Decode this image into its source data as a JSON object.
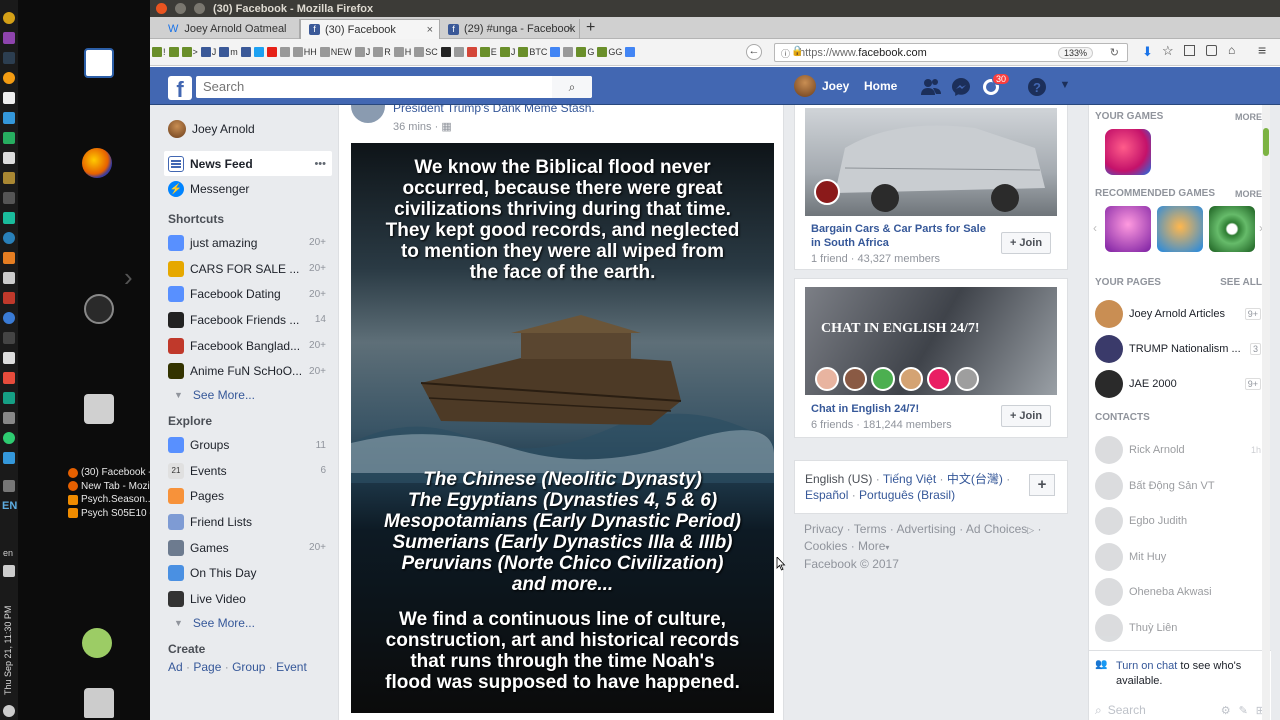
{
  "desktop": {
    "clock": "Thu Sep 21, 11:30 PM",
    "lang": "EN",
    "lang_small": "en",
    "tasks": [
      {
        "label": "(30) Facebook -...",
        "color": "#e66000"
      },
      {
        "label": "New Tab - Mozi...",
        "color": "#e66000"
      },
      {
        "label": "Psych.Season....",
        "color": "#f08c00"
      },
      {
        "label": "Psych S05E10 -...",
        "color": "#f08c00"
      }
    ]
  },
  "firefox": {
    "window_title": "(30) Facebook - Mozilla Firefox",
    "tabs": [
      {
        "label": "Joey Arnold Oatmeal"
      },
      {
        "label": "(30) Facebook"
      },
      {
        "label": "(29) #unga - Facebook"
      }
    ],
    "new_tab": "+",
    "bookmarks": [
      "!",
      ">",
      "J",
      "m",
      "HH",
      "NEW",
      "J",
      "R",
      "H",
      "SC",
      "E",
      "J",
      "BTC",
      "G",
      "G",
      "GG"
    ],
    "url_prefix": "https://www.",
    "url_domain": "facebook.com",
    "zoom": "133%"
  },
  "fb": {
    "logo": "f",
    "search_placeholder": "Search",
    "profile_name": "Joey",
    "home": "Home",
    "notif_count": "30",
    "left": {
      "user": "Joey Arnold",
      "news_feed": "News Feed",
      "news_feed_more": "•••",
      "messenger": "Messenger",
      "shortcuts_title": "Shortcuts",
      "shortcuts": [
        {
          "label": "just amazing",
          "count": "20+",
          "color": "#5890ff"
        },
        {
          "label": "CARS FOR SALE ...",
          "count": "20+",
          "color": "#e6a800"
        },
        {
          "label": "Facebook Dating",
          "count": "20+",
          "color": "#5890ff"
        },
        {
          "label": "Facebook Friends ...",
          "count": "14",
          "color": "#222222"
        },
        {
          "label": "Facebook Banglad...",
          "count": "20+",
          "color": "#c0392b"
        },
        {
          "label": "Anime FuN ScHoO...",
          "count": "20+",
          "color": "#333300"
        }
      ],
      "see_more": "See More...",
      "explore_title": "Explore",
      "explore": [
        {
          "label": "Groups",
          "count": "11",
          "color": "#5890ff"
        },
        {
          "label": "Events",
          "count": "6",
          "color": "#e0e0e0",
          "glyph": "21"
        },
        {
          "label": "Pages",
          "count": "",
          "color": "#f7923a"
        },
        {
          "label": "Friend Lists",
          "count": "",
          "color": "#7e9bd4"
        },
        {
          "label": "Games",
          "count": "20+",
          "color": "#6d7b8f"
        },
        {
          "label": "On This Day",
          "count": "",
          "color": "#4a90e2"
        },
        {
          "label": "Live Video",
          "count": "",
          "color": "#333333"
        }
      ],
      "see_more2": "See More...",
      "create_title": "Create",
      "create_links": [
        "Ad",
        "Page",
        "Group",
        "Event"
      ]
    },
    "post": {
      "page_name": "President Trump's Dank Meme Stash.",
      "time": "36 mins",
      "text_top": [
        "We know the Biblical flood never",
        "occurred, because there were great",
        "civilizations thriving during that time.",
        "They kept good records, and neglected",
        "to mention they were all wiped from",
        "the face of the earth."
      ],
      "text_mid": [
        "The Chinese (Neolitic Dynasty)",
        "The Egyptians (Dynasties 4, 5 & 6)",
        "Mesopotamians (Early Dynastic Period)",
        "Sumerians (Early Dynastics IIIa & IIIb)",
        "Peruvians (Norte Chico Civilization)",
        "and more..."
      ],
      "text_bot": [
        "We find a continuous line of culture,",
        "construction, art and historical records",
        "that runs through the time Noah's",
        "flood was supposed to have happened."
      ]
    },
    "groups": [
      {
        "name": "Bargain Cars & Car Parts for Sale in South Africa",
        "meta": "1 friend · 43,327 members",
        "join": "Join"
      },
      {
        "name": "Chat in English 24/7!",
        "meta": "6 friends · 181,244 members",
        "join": "Join",
        "banner": "CHAT IN ENGLISH 24/7!"
      }
    ],
    "languages": [
      "English (US)",
      "Tiếng Việt",
      "中文(台灣)",
      "Español",
      "Português (Brasil)"
    ],
    "footer_links": [
      "Privacy",
      "Terms",
      "Advertising",
      "Ad Choices",
      "Cookies",
      "More"
    ],
    "copyright": "Facebook © 2017",
    "sidebar": {
      "your_games": "YOUR GAMES",
      "more": "MORE",
      "recommended_games": "RECOMMENDED GAMES",
      "your_pages": "YOUR PAGES",
      "see_all": "SEE ALL",
      "pages": [
        {
          "name": "Joey Arnold Articles",
          "count": "9+"
        },
        {
          "name": "TRUMP Nationalism ...",
          "count": "3"
        },
        {
          "name": "JAE 2000",
          "count": "9+"
        }
      ],
      "contacts_title": "CONTACTS",
      "contacts": [
        {
          "name": "Rick Arnold",
          "status": "1h"
        },
        {
          "name": "Bất Động Sản VT",
          "status": ""
        },
        {
          "name": "Egbo Judith",
          "status": ""
        },
        {
          "name": "Mit Huy",
          "status": ""
        },
        {
          "name": "Oheneba Akwasi",
          "status": ""
        },
        {
          "name": "Thuỳ Liên",
          "status": ""
        }
      ],
      "turn_on_chat": "Turn on chat",
      "turn_on_chat_rest": " to see who's available.",
      "chat_search": "Search"
    }
  }
}
